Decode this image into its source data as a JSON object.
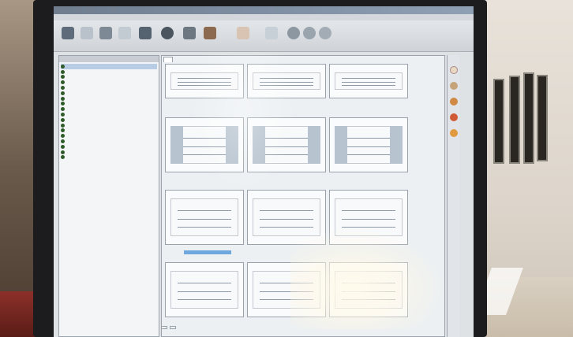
{
  "scene": {
    "colors": {
      "bezel": "#1c1c1e",
      "wall": "#e8e2da",
      "screen_bg": "#dfe2e4",
      "tree_dot": "#2f5b2a",
      "link": "#2a4fb8"
    }
  },
  "app": {
    "window_title": "",
    "menu": [],
    "toolbar_icons": [
      "open-folder-icon",
      "arrow-icon",
      "monitor-icon",
      "document-icon",
      "stack-icon",
      "sphere-icon",
      "cart-icon",
      "car-icon",
      "wrench-icon",
      "arrow-diag-icon",
      "check-icon",
      "refresh-icon",
      "circle-icon"
    ],
    "tree": {
      "header": {
        "col1": "",
        "col2": ""
      },
      "rows": [
        {
          "c1": "",
          "c2": ""
        },
        {
          "c1": "",
          "c2": ""
        },
        {
          "c1": "",
          "c2": ""
        },
        {
          "c1": "",
          "c2": ""
        },
        {
          "c1": "",
          "c2": ""
        },
        {
          "c1": "",
          "c2": ""
        },
        {
          "c1": "",
          "c2": ""
        },
        {
          "c1": "",
          "c2": ""
        },
        {
          "c1": "",
          "c2": ""
        },
        {
          "c1": "",
          "c2": ""
        },
        {
          "c1": "",
          "c2": ""
        },
        {
          "c1": "",
          "c2": ""
        },
        {
          "c1": "",
          "c2": ""
        },
        {
          "c1": "",
          "c2": ""
        },
        {
          "c1": "",
          "c2": ""
        },
        {
          "c1": "",
          "c2": ""
        },
        {
          "c1": "",
          "c2": ""
        },
        {
          "c1": "",
          "c2": ""
        }
      ],
      "links": [
        "",
        "",
        "",
        ""
      ]
    },
    "main": {
      "tab": "",
      "panels": [
        {
          "caption": ""
        },
        {
          "caption": ""
        },
        {
          "caption": ""
        },
        {
          "caption": ""
        },
        {
          "caption": ""
        },
        {
          "caption": ""
        },
        {
          "caption": ""
        },
        {
          "caption": ""
        },
        {
          "caption": ""
        },
        {
          "caption": ""
        },
        {
          "caption": ""
        },
        {
          "caption": ""
        }
      ]
    },
    "right_toolbar_icons": [
      "home-icon",
      "gear-icon",
      "speaker-icon",
      "stop-icon",
      "flame-icon"
    ],
    "status": {
      "field1": "",
      "field2": ""
    }
  }
}
